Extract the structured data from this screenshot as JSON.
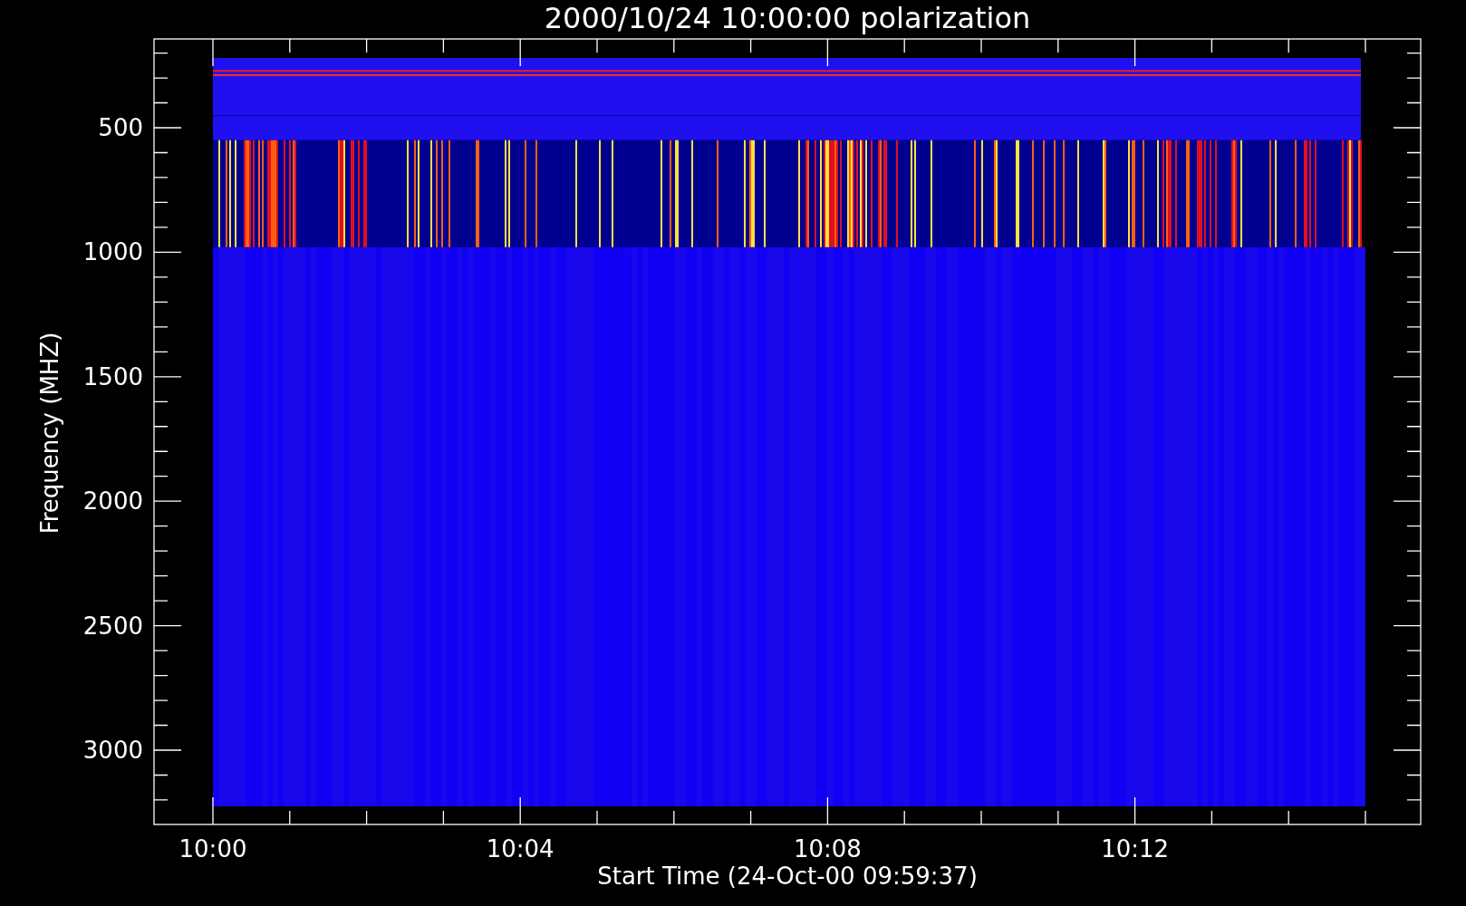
{
  "plot": {
    "title": "2000/10/24 10:00:00 polarization",
    "ylabel": "Frequency (MHZ)",
    "xlabel": "Start Time (24-Oct-00 09:59:37)",
    "yticks": [
      "500",
      "1000",
      "1500",
      "2000",
      "2500",
      "3000"
    ],
    "xticks": [
      "10:00",
      "10:04",
      "10:08",
      "10:12"
    ]
  }
}
